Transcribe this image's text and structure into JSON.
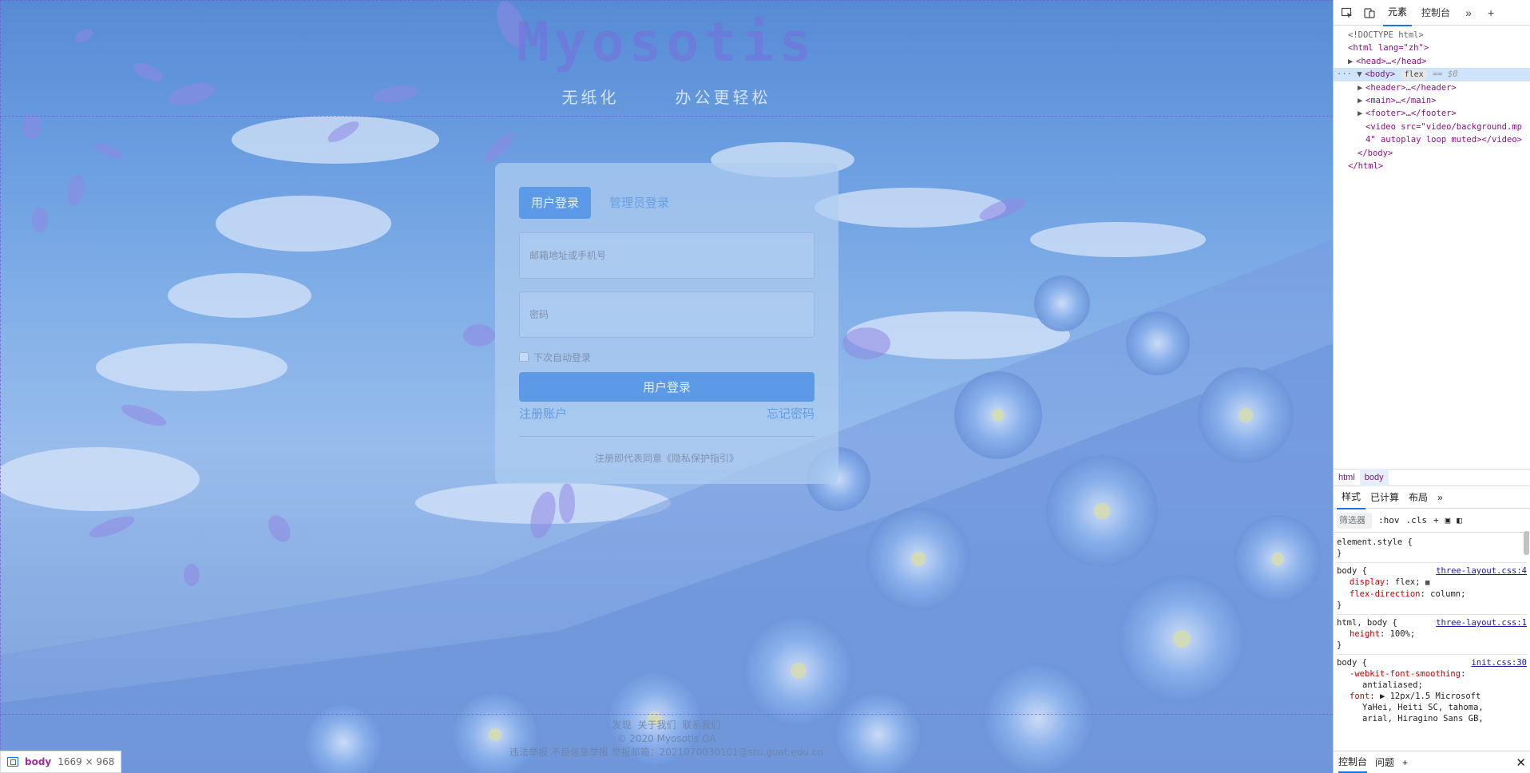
{
  "page": {
    "logo": "Myosotis",
    "slogans": [
      "无纸化",
      "办公更轻松"
    ],
    "login": {
      "tabs": [
        "用户登录",
        "管理员登录"
      ],
      "email_placeholder": "邮箱地址或手机号",
      "password_placeholder": "密码",
      "remember_label": "下次自动登录",
      "submit_label": "用户登录",
      "register_link": "注册账户",
      "forgot_link": "忘记密码",
      "agreement": "注册即代表同意《隐私保护指引》"
    },
    "footer": {
      "links": [
        "发现",
        "关于我们",
        "联系我们"
      ],
      "copyright": "© 2020 Myosotis OA",
      "report": "违法举报 不良信息举报 举报邮箱：2021070030101@stu.guat.edu.cn"
    },
    "dimension_tag": {
      "name": "body",
      "size": "1669 × 968"
    }
  },
  "devtools": {
    "tabs": [
      "元素",
      "控制台"
    ],
    "dom": {
      "doctype": "<!DOCTYPE html>",
      "html_open": "<html lang=\"zh\">",
      "head": "<head>…</head>",
      "body_open": "<body>",
      "body_pill": "flex",
      "body_eq": "== $0",
      "header": "<header>…</header>",
      "main": "<main>…</main>",
      "footer": "<footer>…</footer>",
      "video_1": "<video src=\"video/background.mp",
      "video_2": "4\" autoplay loop muted></video>",
      "body_close": "</body>",
      "html_close": "</html>"
    },
    "breadcrumbs": [
      "html",
      "body"
    ],
    "style_tabs": [
      "样式",
      "已计算",
      "布局"
    ],
    "filter_placeholder": "筛选器",
    "filter_buttons": [
      ":hov",
      ".cls"
    ],
    "rules": [
      {
        "selector": "element.style {",
        "source": "",
        "props": []
      },
      {
        "selector": "body {",
        "source": "three-layout.css:4",
        "props": [
          [
            "display",
            "flex;"
          ],
          [
            "flex-direction",
            "column;"
          ]
        ]
      },
      {
        "selector": "html, body {",
        "source": "three-layout.css:1",
        "props": [
          [
            "height",
            "100%;"
          ]
        ]
      },
      {
        "selector": "body {",
        "source": "init.css:30",
        "props": [
          [
            "-webkit-font-smoothing",
            ""
          ],
          [
            "",
            "antialiased;"
          ],
          [
            "font",
            "12px/1.5 Microsoft"
          ],
          [
            "",
            "YaHei, Heiti SC, tahoma,"
          ],
          [
            "",
            "arial, Hiragino Sans GB,"
          ]
        ]
      }
    ],
    "drawer_tabs": [
      "控制台",
      "问题"
    ]
  },
  "colors": {
    "accent": "#5c9ae8",
    "link": "#5f9be8",
    "devtools_accent": "#1a73e8"
  }
}
